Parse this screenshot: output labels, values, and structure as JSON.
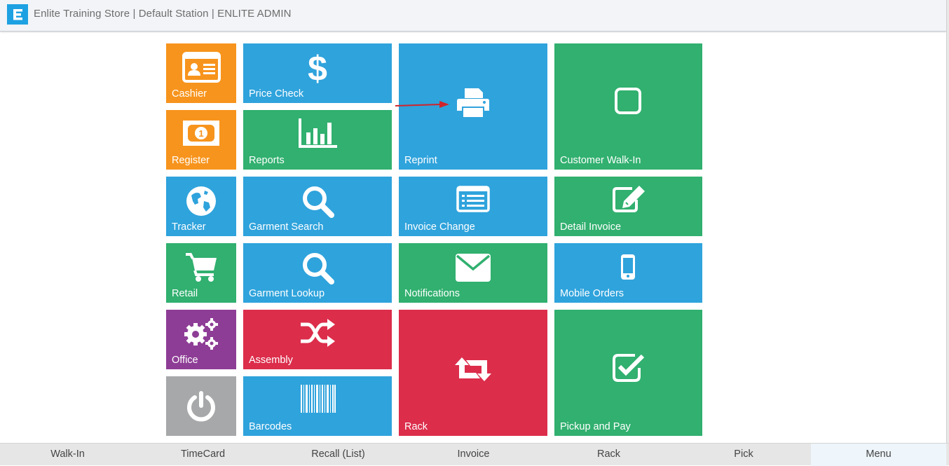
{
  "header": {
    "title": "Enlite Training Store | Default Station | ENLITE ADMIN",
    "logo_letter": "E"
  },
  "tiles": {
    "cashier": "Cashier",
    "price_check": "Price Check",
    "reprint": "Reprint",
    "customer_walk_in": "Customer Walk-In",
    "register": "Register",
    "reports": "Reports",
    "tracker": "Tracker",
    "garment_search": "Garment Search",
    "invoice_change": "Invoice Change",
    "detail_invoice": "Detail Invoice",
    "retail": "Retail",
    "garment_lookup": "Garment Lookup",
    "notifications": "Notifications",
    "mobile_orders": "Mobile Orders",
    "office": "Office",
    "assembly": "Assembly",
    "rack": "Rack",
    "pickup_and_pay": "Pickup and Pay",
    "barcodes": "Barcodes"
  },
  "bottom_nav": [
    {
      "label": "Walk-In"
    },
    {
      "label": "TimeCard"
    },
    {
      "label": "Recall (List)"
    },
    {
      "label": "Invoice"
    },
    {
      "label": "Rack"
    },
    {
      "label": "Pick"
    },
    {
      "label": "Menu"
    }
  ],
  "colors": {
    "blue": "#2fa3dc",
    "green": "#31b06f",
    "orange": "#f7941d",
    "red": "#dc2d4b",
    "purple": "#8e3d96",
    "gray": "#a7a8a9",
    "annotation_arrow": "#d0242b",
    "logo": "#1da1e2"
  },
  "icons": {
    "cashier": "id-card-icon",
    "price_check": "dollar-icon",
    "reprint": "printer-icon",
    "customer_walk_in": "empty-square-icon",
    "register": "money-bill-icon",
    "reports": "bar-chart-icon",
    "tracker": "globe-icon",
    "garment_search": "search-icon",
    "invoice_change": "list-card-icon",
    "detail_invoice": "edit-icon",
    "retail": "shopping-cart-icon",
    "garment_lookup": "search-icon",
    "notifications": "envelope-icon",
    "mobile_orders": "mobile-phone-icon",
    "office": "gears-icon",
    "assembly": "shuffle-icon",
    "rack": "retweet-icon",
    "pickup_and_pay": "check-square-icon",
    "power": "power-icon",
    "barcodes": "barcode-icon"
  }
}
